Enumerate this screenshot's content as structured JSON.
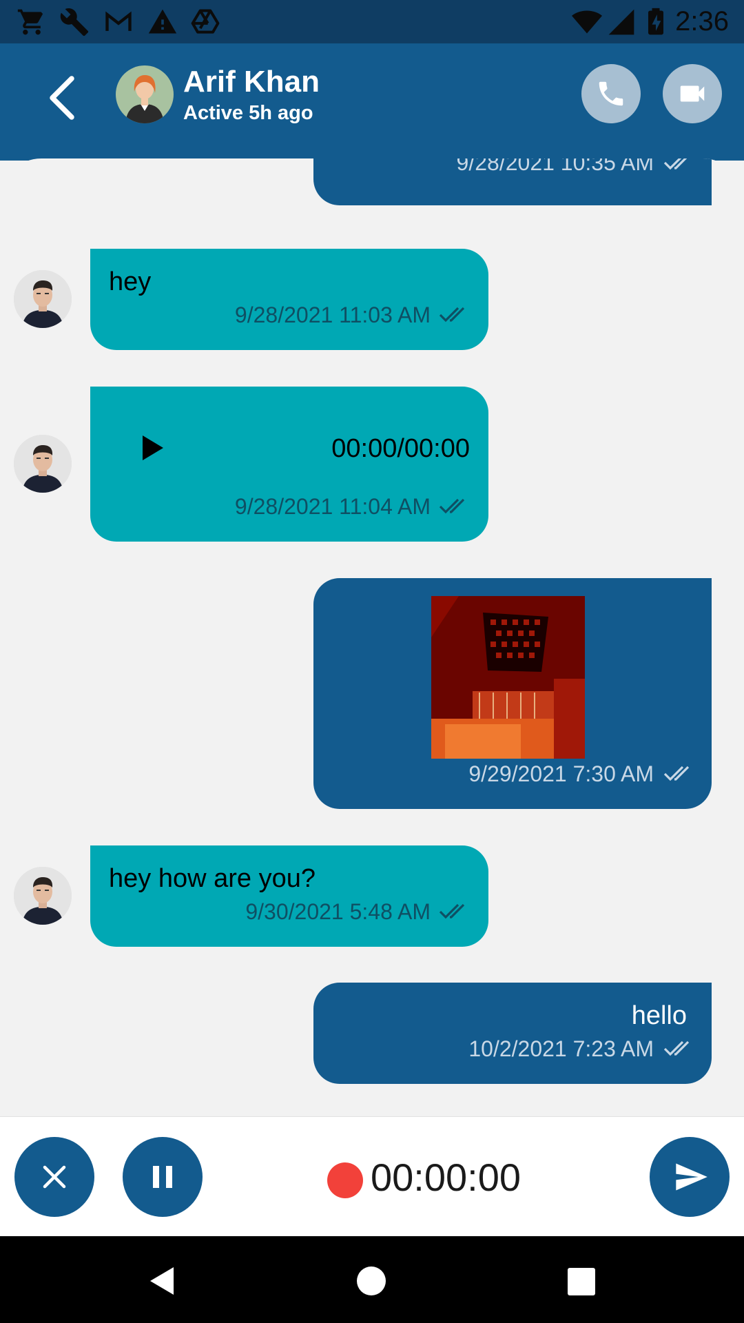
{
  "status_bar": {
    "time": "2:36",
    "left_icons": [
      "cart-icon",
      "wrench-icon",
      "gmail-icon",
      "warning-icon",
      "drive-icon"
    ],
    "right_icons": [
      "wifi-icon",
      "signal-icon",
      "battery-charging-icon"
    ]
  },
  "header": {
    "contact_name": "Arif Khan",
    "status": "Active 5h ago",
    "accent": "#135b8e"
  },
  "messages": [
    {
      "id": 0,
      "direction": "outgoing",
      "text": "",
      "time": "9/28/2021 10:35 AM",
      "partially_visible": true
    },
    {
      "id": 1,
      "direction": "incoming",
      "text": "hey",
      "time": "9/28/2021 11:03 AM"
    },
    {
      "id": 2,
      "direction": "incoming",
      "type": "audio",
      "duration": "00:00/00:00",
      "time": "9/28/2021 11:04 AM"
    },
    {
      "id": 3,
      "direction": "outgoing",
      "type": "image",
      "time": "9/29/2021 7:30 AM"
    },
    {
      "id": 4,
      "direction": "incoming",
      "text": "hey how are you?",
      "time": "9/30/2021 5:48 AM"
    },
    {
      "id": 5,
      "direction": "outgoing",
      "text": "hello",
      "time": "10/2/2021 7:23 AM"
    }
  ],
  "composer": {
    "recording_time": "00:00:00",
    "recording_color": "#f2413a"
  },
  "colors": {
    "incoming_bubble": "#00a8b4",
    "outgoing_bubble": "#135b8e",
    "chat_background": "#f2f2f2"
  }
}
